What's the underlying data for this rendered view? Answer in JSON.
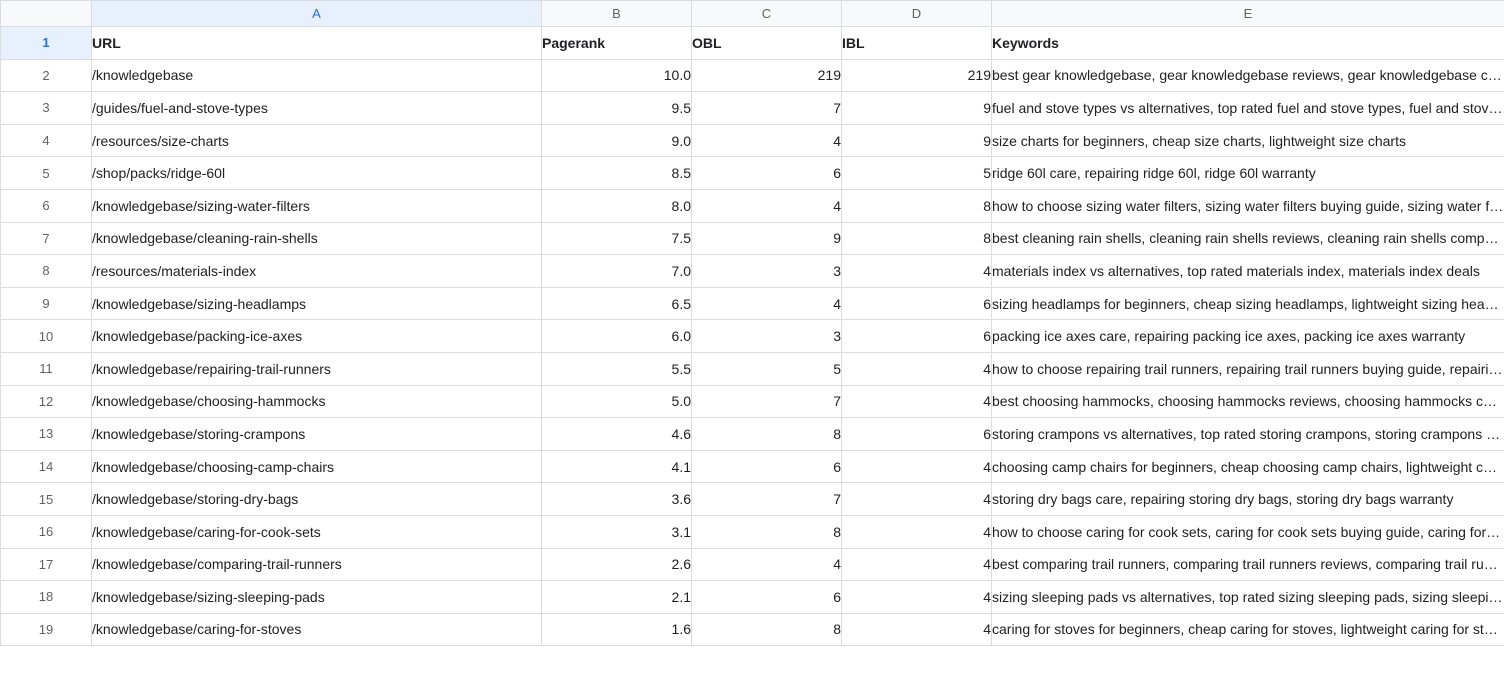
{
  "sheet": {
    "column_letters": [
      "A",
      "B",
      "C",
      "D",
      "E"
    ],
    "selected_column": "A",
    "selected_row": "1",
    "header_row": {
      "row_number": "1",
      "cells": [
        "URL",
        "Pagerank",
        "OBL",
        "IBL",
        "Keywords"
      ]
    },
    "rows": [
      {
        "n": "2",
        "url": "/knowledgebase",
        "pagerank": "10.0",
        "obl": "219",
        "ibl": "219",
        "keywords": "best gear knowledgebase, gear knowledgebase reviews, gear knowledgebase comparison"
      },
      {
        "n": "3",
        "url": "/guides/fuel-and-stove-types",
        "pagerank": "9.5",
        "obl": "7",
        "ibl": "9",
        "keywords": "fuel and stove types vs alternatives, top rated fuel and stove types, fuel and stove types deals"
      },
      {
        "n": "4",
        "url": "/resources/size-charts",
        "pagerank": "9.0",
        "obl": "4",
        "ibl": "9",
        "keywords": "size charts for beginners, cheap size charts, lightweight size charts"
      },
      {
        "n": "5",
        "url": "/shop/packs/ridge-60l",
        "pagerank": "8.5",
        "obl": "6",
        "ibl": "5",
        "keywords": "ridge 60l care, repairing ridge 60l, ridge 60l warranty"
      },
      {
        "n": "6",
        "url": "/knowledgebase/sizing-water-filters",
        "pagerank": "8.0",
        "obl": "4",
        "ibl": "8",
        "keywords": "how to choose sizing water filters, sizing water filters buying guide, sizing water filters tips"
      },
      {
        "n": "7",
        "url": "/knowledgebase/cleaning-rain-shells",
        "pagerank": "7.5",
        "obl": "9",
        "ibl": "8",
        "keywords": "best cleaning rain shells, cleaning rain shells reviews, cleaning rain shells comparison"
      },
      {
        "n": "8",
        "url": "/resources/materials-index",
        "pagerank": "7.0",
        "obl": "3",
        "ibl": "4",
        "keywords": "materials index vs alternatives, top rated materials index, materials index deals"
      },
      {
        "n": "9",
        "url": "/knowledgebase/sizing-headlamps",
        "pagerank": "6.5",
        "obl": "4",
        "ibl": "6",
        "keywords": "sizing headlamps for beginners, cheap sizing headlamps, lightweight sizing headlamps"
      },
      {
        "n": "10",
        "url": "/knowledgebase/packing-ice-axes",
        "pagerank": "6.0",
        "obl": "3",
        "ibl": "6",
        "keywords": "packing ice axes care, repairing packing ice axes, packing ice axes warranty"
      },
      {
        "n": "11",
        "url": "/knowledgebase/repairing-trail-runners",
        "pagerank": "5.5",
        "obl": "5",
        "ibl": "4",
        "keywords": "how to choose repairing trail runners, repairing trail runners buying guide, repairing trail runners tips"
      },
      {
        "n": "12",
        "url": "/knowledgebase/choosing-hammocks",
        "pagerank": "5.0",
        "obl": "7",
        "ibl": "4",
        "keywords": "best choosing hammocks, choosing hammocks reviews, choosing hammocks comparison"
      },
      {
        "n": "13",
        "url": "/knowledgebase/storing-crampons",
        "pagerank": "4.6",
        "obl": "8",
        "ibl": "6",
        "keywords": "storing crampons vs alternatives, top rated storing crampons, storing crampons deals"
      },
      {
        "n": "14",
        "url": "/knowledgebase/choosing-camp-chairs",
        "pagerank": "4.1",
        "obl": "6",
        "ibl": "4",
        "keywords": "choosing camp chairs for beginners, cheap choosing camp chairs, lightweight choosing camp chairs"
      },
      {
        "n": "15",
        "url": "/knowledgebase/storing-dry-bags",
        "pagerank": "3.6",
        "obl": "7",
        "ibl": "4",
        "keywords": "storing dry bags care, repairing storing dry bags, storing dry bags warranty"
      },
      {
        "n": "16",
        "url": "/knowledgebase/caring-for-cook-sets",
        "pagerank": "3.1",
        "obl": "8",
        "ibl": "4",
        "keywords": "how to choose caring for cook sets, caring for cook sets buying guide, caring for cook sets tips"
      },
      {
        "n": "17",
        "url": "/knowledgebase/comparing-trail-runners",
        "pagerank": "2.6",
        "obl": "4",
        "ibl": "4",
        "keywords": "best comparing trail runners, comparing trail runners reviews, comparing trail runners comparison"
      },
      {
        "n": "18",
        "url": "/knowledgebase/sizing-sleeping-pads",
        "pagerank": "2.1",
        "obl": "6",
        "ibl": "4",
        "keywords": "sizing sleeping pads vs alternatives, top rated sizing sleeping pads, sizing sleeping pads deals"
      },
      {
        "n": "19",
        "url": "/knowledgebase/caring-for-stoves",
        "pagerank": "1.6",
        "obl": "8",
        "ibl": "4",
        "keywords": "caring for stoves for beginners, cheap caring for stoves, lightweight caring for stoves"
      }
    ]
  },
  "colors": {
    "grid_line": "#dadce0",
    "header_bg": "#f8f9fa",
    "selection_bg": "#e8f0fe",
    "selection_text": "#1a73e8",
    "cell_text": "#202124",
    "header_text": "#5f6368"
  }
}
